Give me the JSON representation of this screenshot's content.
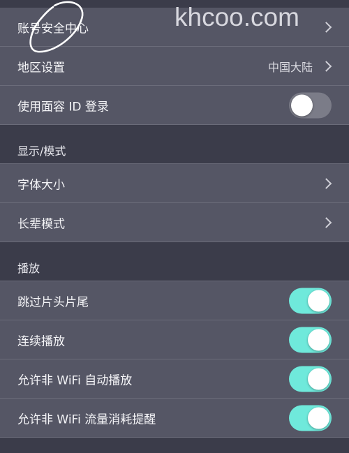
{
  "watermark": "khcoo.com",
  "account": {
    "security_center": "账号安全中心",
    "region": {
      "label": "地区设置",
      "value": "中国大陆"
    },
    "face_id_login": {
      "label": "使用面容 ID 登录",
      "enabled": false
    }
  },
  "display_section": {
    "title": "显示/模式",
    "font_size": "字体大小",
    "elder_mode": "长辈模式"
  },
  "playback_section": {
    "title": "播放",
    "skip_intro_outro": {
      "label": "跳过片头片尾",
      "enabled": true
    },
    "continuous_play": {
      "label": "连续播放",
      "enabled": true
    },
    "autoplay_non_wifi": {
      "label": "允许非 WiFi 自动播放",
      "enabled": true
    },
    "data_usage_reminder": {
      "label": "允许非 WiFi 流量消耗提醒",
      "enabled": true
    }
  },
  "colors": {
    "background": "#3b3c4a",
    "row": "#555665",
    "toggle_on": "#6fe9db",
    "toggle_off": "#7b7c88"
  }
}
